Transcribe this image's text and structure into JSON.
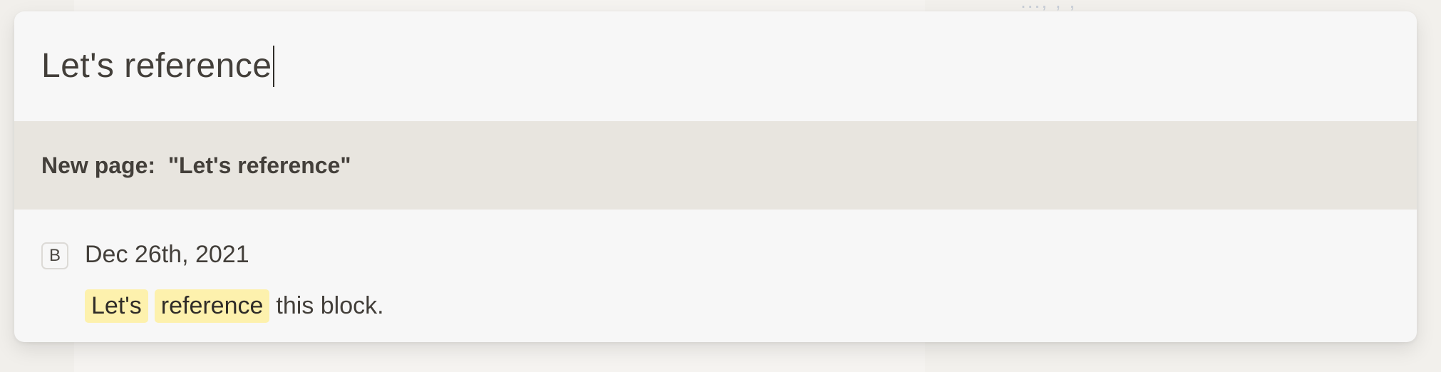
{
  "background": {
    "faint_text": "..., , ,"
  },
  "search": {
    "query": "Let's reference"
  },
  "new_page": {
    "label": "New page:  \"Let's reference\""
  },
  "results": [
    {
      "badge": "B",
      "title": "Dec 26th, 2021",
      "highlights": [
        "Let's",
        "reference"
      ],
      "rest": "this block."
    }
  ],
  "colors": {
    "highlight": "#fdf1ad",
    "selected_row": "#e8e5df",
    "text": "#433f3a"
  }
}
